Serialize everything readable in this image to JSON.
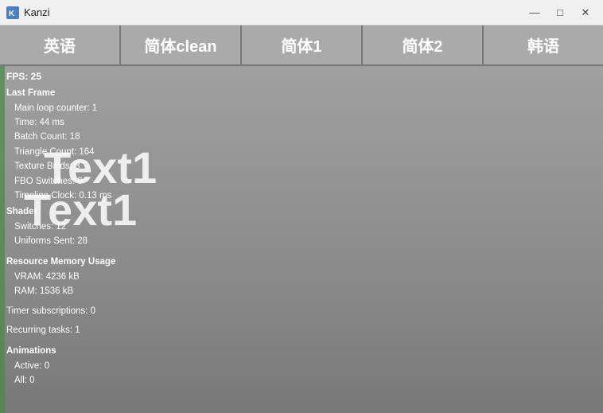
{
  "window": {
    "title": "Kanzi",
    "icon": "K"
  },
  "titlebar": {
    "minimize_label": "—",
    "maximize_label": "□",
    "close_label": "✕"
  },
  "tabs": [
    {
      "id": "tab-yingyu",
      "label": "英语"
    },
    {
      "id": "tab-jianti-clean",
      "label": "简体clean"
    },
    {
      "id": "tab-jianti1",
      "label": "简体1"
    },
    {
      "id": "tab-jianti2",
      "label": "简体2"
    },
    {
      "id": "tab-hanyu",
      "label": "韩语"
    }
  ],
  "info": {
    "fps": "FPS: 25",
    "last_frame": "Last Frame",
    "main_loop_counter": "Main loop counter: 1",
    "time": "Time: 44 ms",
    "batch_count": "Batch Count: 18",
    "triangle_count": "Triangle Count: 164",
    "texture_binds": "Texture Binds: 3",
    "fbo_switches": "FBO Switches: 0",
    "timeline_clock": "Timeline Clock: 0.13 ms",
    "shader": "Shader",
    "switches": "Switches: 12",
    "uniforms_sent": "Uniforms Sent: 28",
    "resource_memory": "Resource Memory Usage",
    "vram": "VRAM: 4236 kB",
    "ram": "RAM: 1536 kB",
    "timer_subscriptions": "Timer subscriptions: 0",
    "recurring_tasks": "Recurring tasks: 1",
    "animations": "Animations",
    "active": "Active: 0",
    "all": "All: 0"
  },
  "overlay": {
    "text1": "Text1",
    "text2": "Text1"
  }
}
